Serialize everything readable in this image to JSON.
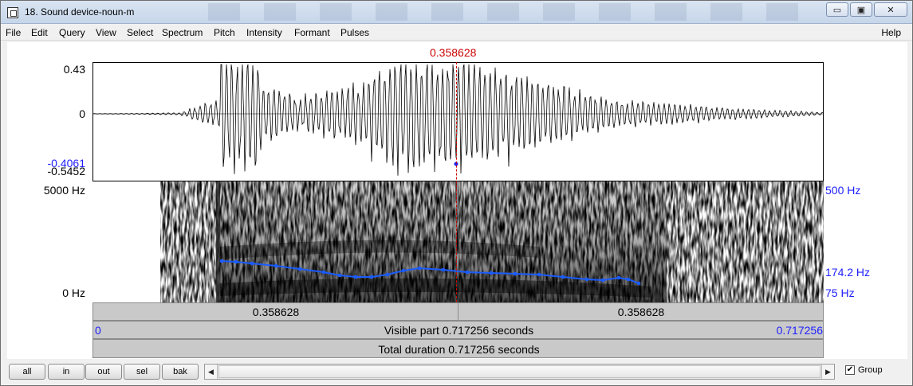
{
  "window": {
    "title": "18. Sound device-noun-m",
    "minimize_glyph": "▭",
    "maximize_glyph": "▣",
    "close_glyph": "✕"
  },
  "menu": {
    "items": [
      "File",
      "Edit",
      "Query",
      "View",
      "Select",
      "Spectrum",
      "Pitch",
      "Intensity",
      "Formant",
      "Pulses"
    ],
    "help": "Help"
  },
  "cursor": {
    "time_label": "0.358628",
    "time_fraction": 0.5
  },
  "waveform": {
    "y_max": "0.43",
    "y_zero": "0",
    "y_cursor_value": "-0.4061",
    "y_min": "-0.5452"
  },
  "spectrogram": {
    "freq_max": "5000 Hz",
    "freq_min": "0 Hz",
    "pitch_max": "500 Hz",
    "pitch_cursor": "174.2 Hz",
    "pitch_min": "75 Hz"
  },
  "timebar": {
    "left_part": "0.358628",
    "right_part": "0.358628",
    "visible_start": "0",
    "visible_label": "Visible part 0.717256 seconds",
    "visible_end": "0.717256",
    "total_label": "Total duration 0.717256 seconds"
  },
  "bottom": {
    "buttons": [
      "all",
      "in",
      "out",
      "sel",
      "bak"
    ],
    "scroll_left": "◀",
    "scroll_right": "▶",
    "group_label": "Group",
    "group_checked": true
  },
  "colors": {
    "cursor": "#cc0000",
    "axis_blue": "#2020ff",
    "pitch_line": "#1a5cff"
  },
  "icons": {
    "app": "sound-window-icon",
    "minimize": "minimize-icon",
    "maximize": "maximize-icon",
    "close": "close-icon",
    "checkbox": "checkmark-icon"
  }
}
